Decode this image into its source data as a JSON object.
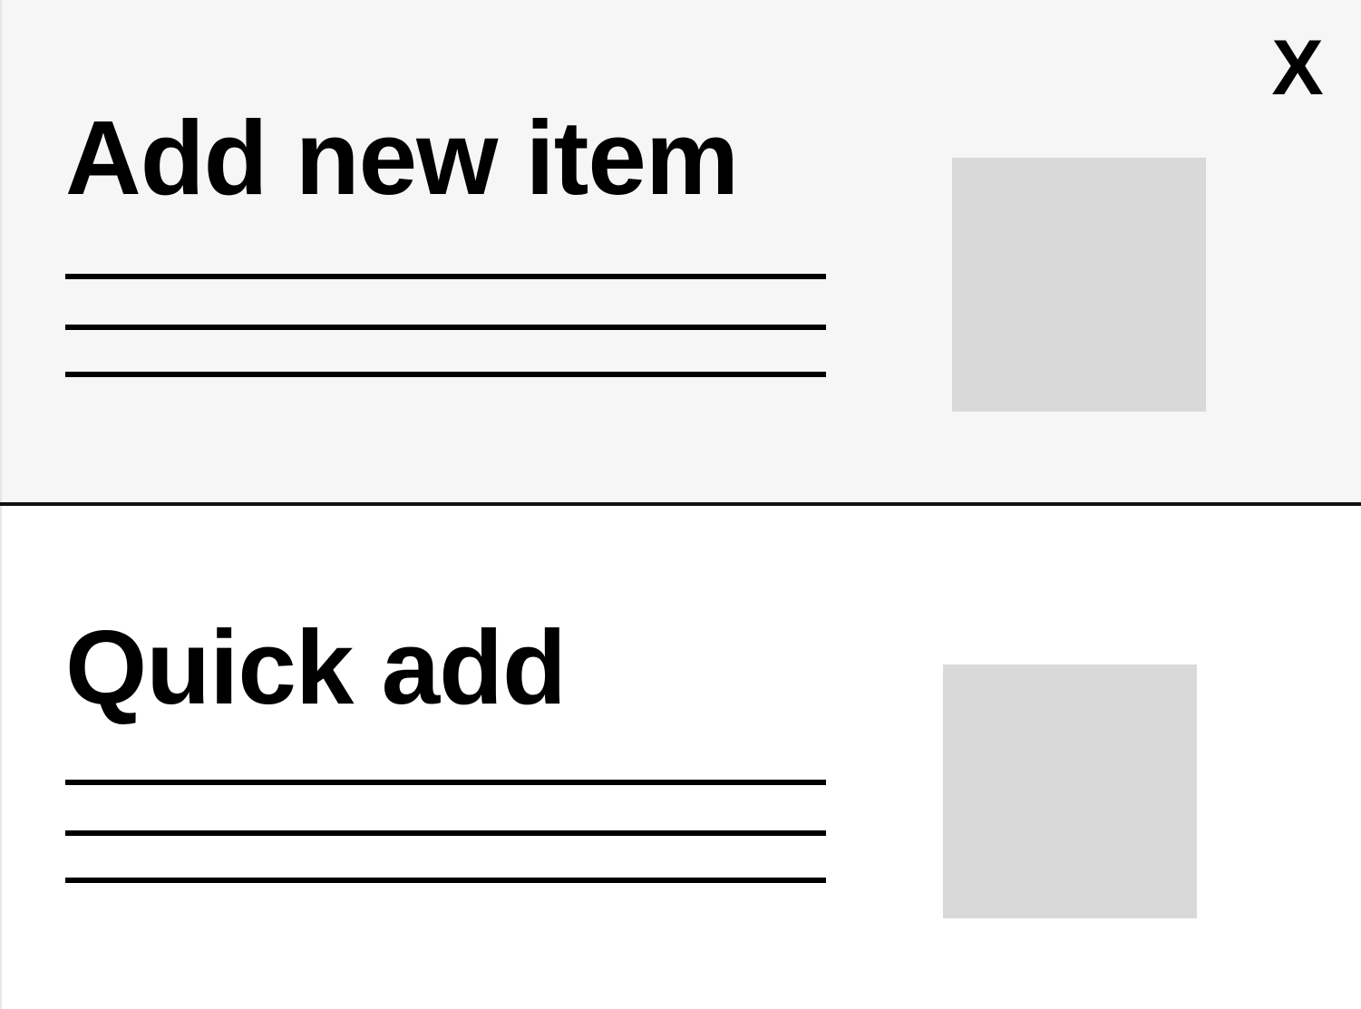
{
  "dialog": {
    "close_label": "X"
  },
  "panels": [
    {
      "title": "Add new item",
      "background": "#f6f6f6",
      "image_placeholder_color": "#d9d9d9"
    },
    {
      "title": "Quick add",
      "background": "#ffffff",
      "image_placeholder_color": "#d9d9d9"
    }
  ]
}
